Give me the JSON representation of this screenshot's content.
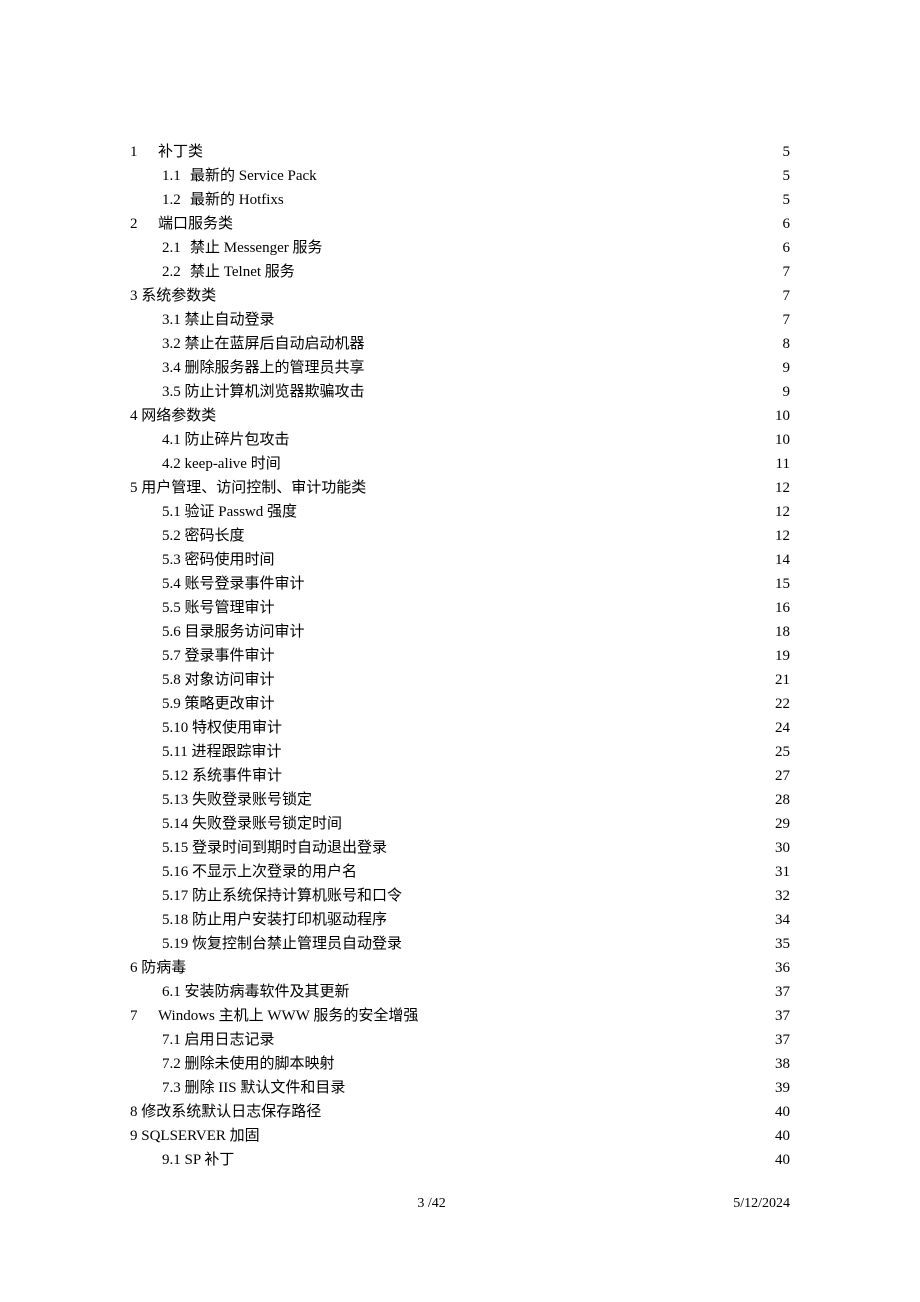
{
  "toc": [
    {
      "level": 0,
      "num": "1",
      "title": "补丁类",
      "page": "5"
    },
    {
      "level": 1,
      "num": "1.1",
      "title": "最新的 Service Pack",
      "page": "5"
    },
    {
      "level": 1,
      "num": "1.2",
      "title": "最新的 Hotfixs",
      "page": "5"
    },
    {
      "level": 0,
      "num": "2",
      "title": "端口服务类",
      "page": "6"
    },
    {
      "level": 1,
      "num": "2.1",
      "title": "禁止 Messenger 服务",
      "page": "6"
    },
    {
      "level": 1,
      "num": "2.2",
      "title": "禁止 Telnet 服务",
      "page": "7"
    },
    {
      "level": 0,
      "num": "",
      "title": "3 系统参数类",
      "page": "7"
    },
    {
      "level": 1,
      "num": "",
      "title": "3.1 禁止自动登录",
      "page": "7"
    },
    {
      "level": 1,
      "num": "",
      "title": "3.2 禁止在蓝屏后自动启动机器",
      "page": "8"
    },
    {
      "level": 1,
      "num": "",
      "title": "3.4 删除服务器上的管理员共享",
      "page": "9"
    },
    {
      "level": 1,
      "num": "",
      "title": "3.5 防止计算机浏览器欺骗攻击",
      "page": "9"
    },
    {
      "level": 0,
      "num": "",
      "title": "4 网络参数类",
      "page": "10"
    },
    {
      "level": 1,
      "num": "",
      "title": "4.1 防止碎片包攻击",
      "page": "10"
    },
    {
      "level": 1,
      "num": "",
      "title": "4.2 keep-alive 时间",
      "page": "11"
    },
    {
      "level": 0,
      "num": "",
      "title": "5 用户管理、访问控制、审计功能类",
      "page": "12"
    },
    {
      "level": 1,
      "num": "",
      "title": "5.1 验证 Passwd 强度",
      "page": "12"
    },
    {
      "level": 1,
      "num": "",
      "title": "5.2 密码长度",
      "page": "12"
    },
    {
      "level": 1,
      "num": "",
      "title": "5.3 密码使用时间",
      "page": "14"
    },
    {
      "level": 1,
      "num": "",
      "title": "5.4 账号登录事件审计",
      "page": "15"
    },
    {
      "level": 1,
      "num": "",
      "title": "5.5 账号管理审计",
      "page": "16"
    },
    {
      "level": 1,
      "num": "",
      "title": "5.6 目录服务访问审计",
      "page": "18"
    },
    {
      "level": 1,
      "num": "",
      "title": "5.7 登录事件审计",
      "page": "19"
    },
    {
      "level": 1,
      "num": "",
      "title": "5.8 对象访问审计",
      "page": "21"
    },
    {
      "level": 1,
      "num": "",
      "title": "5.9 策略更改审计",
      "page": "22"
    },
    {
      "level": 1,
      "num": "",
      "title": "5.10 特权使用审计",
      "page": "24"
    },
    {
      "level": 1,
      "num": "",
      "title": "5.11 进程跟踪审计",
      "page": "25"
    },
    {
      "level": 1,
      "num": "",
      "title": "5.12 系统事件审计",
      "page": "27"
    },
    {
      "level": 1,
      "num": "",
      "title": "5.13 失败登录账号锁定",
      "page": "28"
    },
    {
      "level": 1,
      "num": "",
      "title": "5.14 失败登录账号锁定时间",
      "page": "29"
    },
    {
      "level": 1,
      "num": "",
      "title": "5.15 登录时间到期时自动退出登录",
      "page": "30"
    },
    {
      "level": 1,
      "num": "",
      "title": "5.16 不显示上次登录的用户名",
      "page": "31"
    },
    {
      "level": 1,
      "num": "",
      "title": "5.17  防止系统保持计算机账号和口令",
      "page": "32"
    },
    {
      "level": 1,
      "num": "",
      "title": "5.18 防止用户安装打印机驱动程序",
      "page": "34"
    },
    {
      "level": 1,
      "num": "",
      "title": "5.19 恢复控制台禁止管理员自动登录",
      "page": "35"
    },
    {
      "level": 0,
      "num": "",
      "title": "6 防病毒",
      "page": "36"
    },
    {
      "level": 1,
      "num": "",
      "title": "6.1 安装防病毒软件及其更新",
      "page": "37"
    },
    {
      "level": 0,
      "num": "7",
      "title": "Windows 主机上 WWW 服务的安全增强",
      "page": "37"
    },
    {
      "level": 1,
      "num": "",
      "title": "7.1 启用日志记录",
      "page": "37"
    },
    {
      "level": 1,
      "num": "",
      "title": "7.2 删除未使用的脚本映射",
      "page": "38"
    },
    {
      "level": 1,
      "num": "",
      "title": "7.3 删除 IIS 默认文件和目录",
      "page": "39"
    },
    {
      "level": 0,
      "num": "",
      "title": "8 修改系统默认日志保存路径",
      "page": "40"
    },
    {
      "level": 0,
      "num": "",
      "title": "9 SQLSERVER 加固",
      "page": "40"
    },
    {
      "level": 1,
      "num": "",
      "title": "9.1 SP 补丁",
      "page": "40"
    }
  ],
  "footer": {
    "page": "3 /42",
    "date": "5/12/2024"
  }
}
